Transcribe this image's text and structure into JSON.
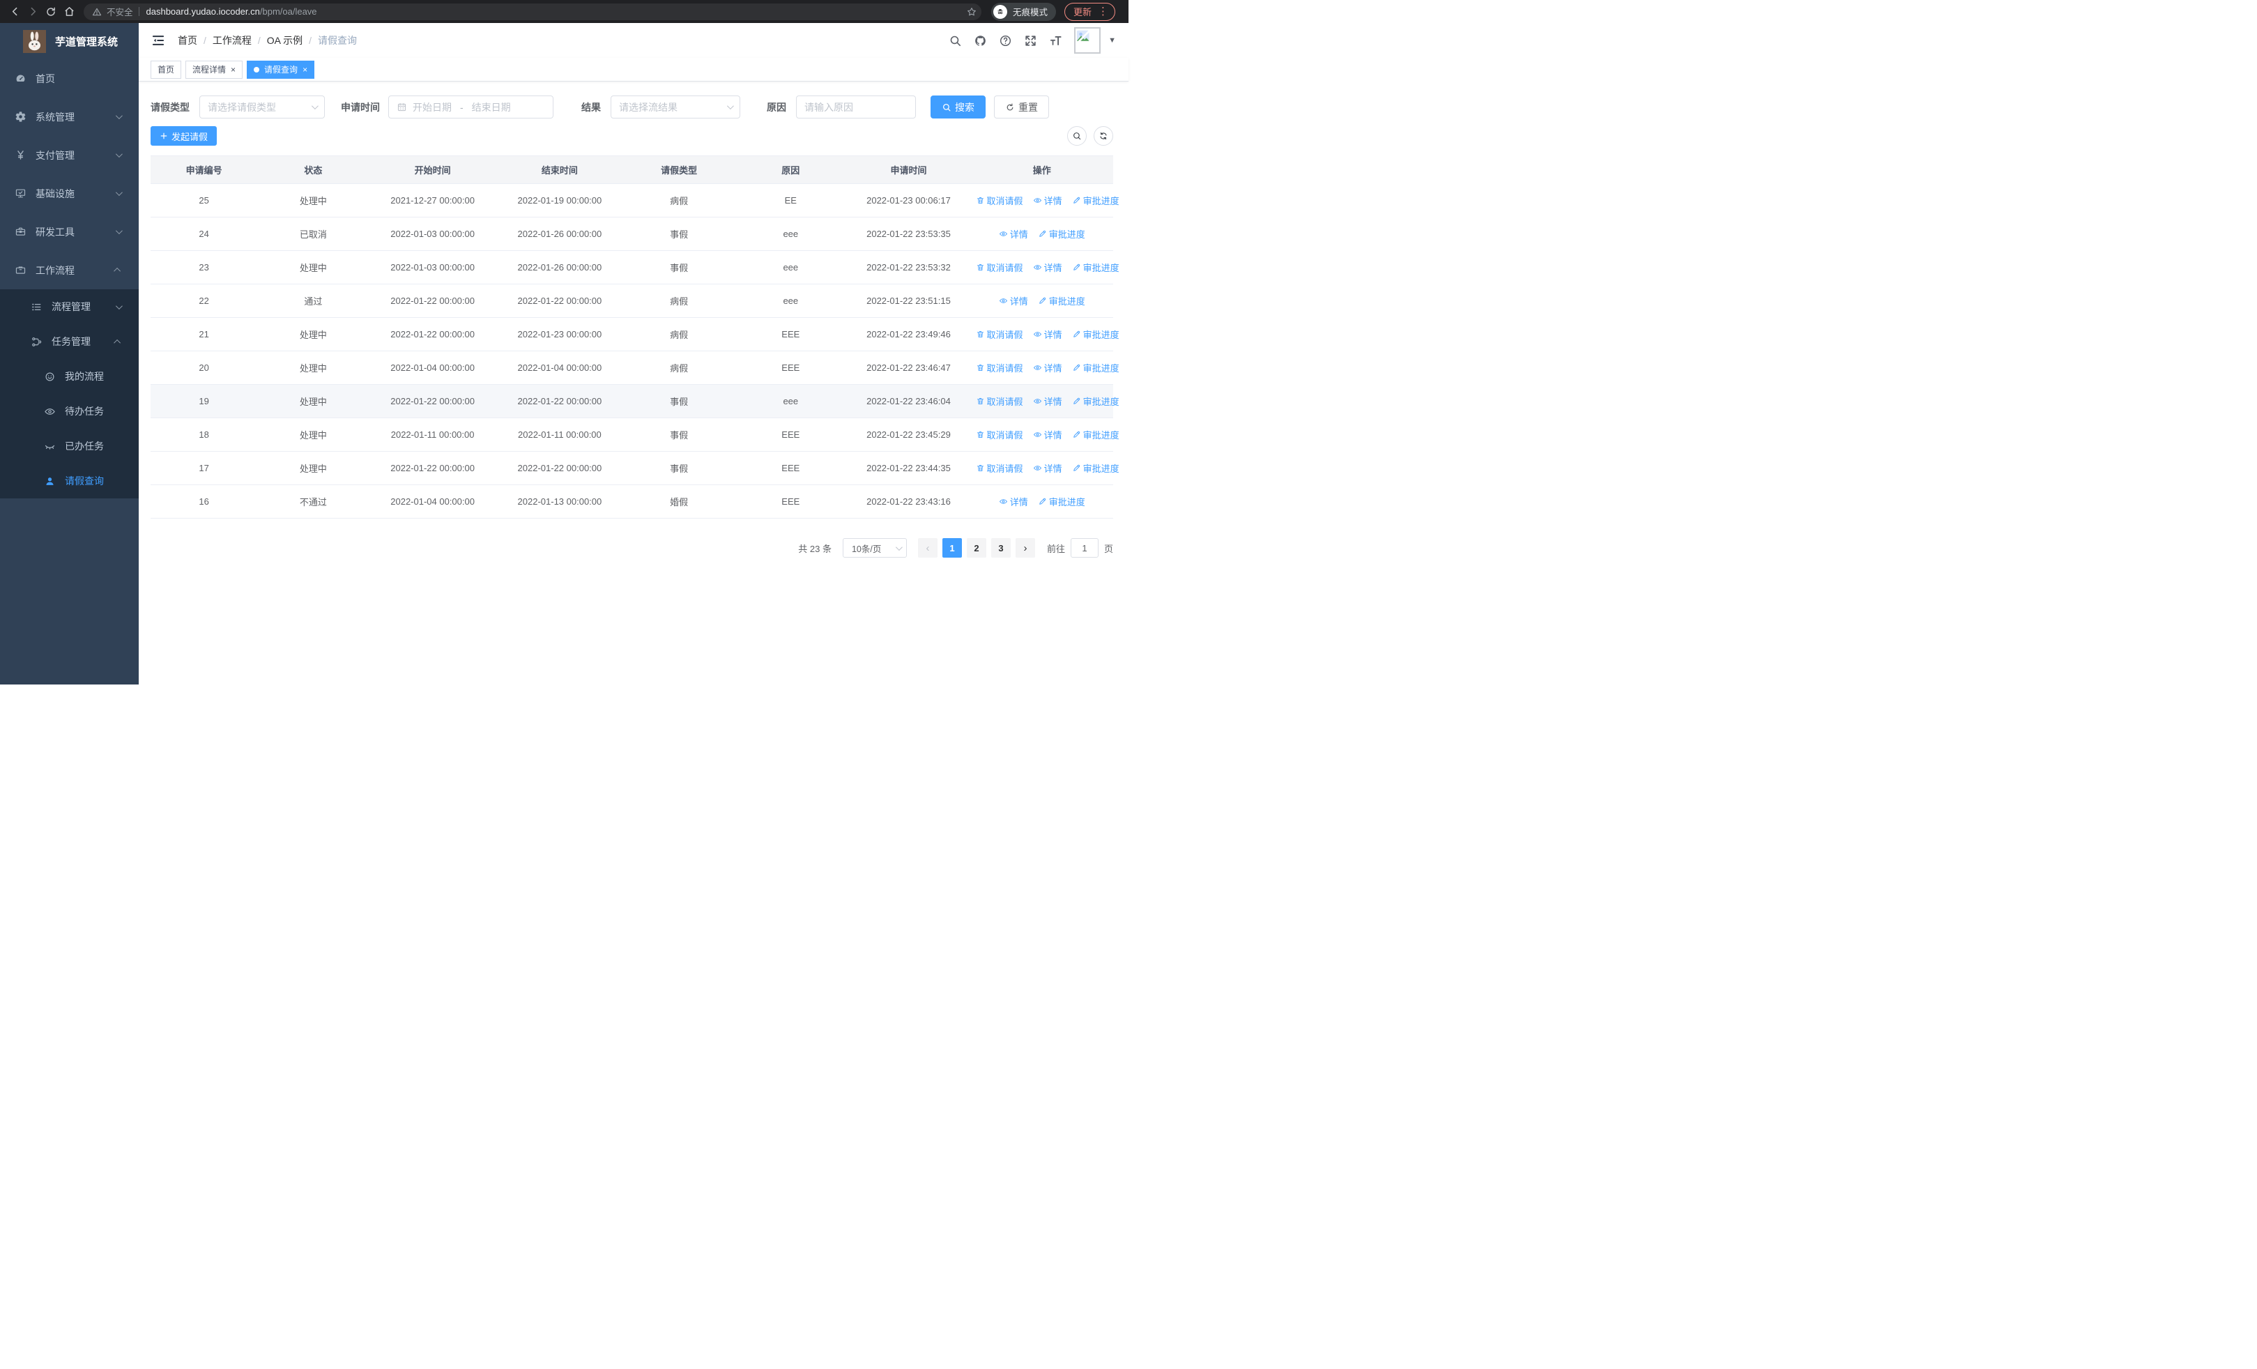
{
  "browser": {
    "security_label": "不安全",
    "url_host": "dashboard.yudao.iocoder.cn",
    "url_path": "/bpm/oa/leave",
    "incognito_label": "无痕模式",
    "update_label": "更新"
  },
  "sidebar": {
    "title": "芋道管理系统",
    "menu": [
      {
        "key": "home",
        "label": "首页",
        "icon": "dashboard",
        "level": 1,
        "chevron": "",
        "active": false
      },
      {
        "key": "system",
        "label": "系统管理",
        "icon": "gear",
        "level": 1,
        "chevron": "down",
        "active": false
      },
      {
        "key": "payment",
        "label": "支付管理",
        "icon": "yen",
        "level": 1,
        "chevron": "down",
        "active": false
      },
      {
        "key": "infrastructure",
        "label": "基础设施",
        "icon": "monitor",
        "level": 1,
        "chevron": "down",
        "active": false
      },
      {
        "key": "dev-tools",
        "label": "研发工具",
        "icon": "toolbox",
        "level": 1,
        "chevron": "down",
        "active": false
      },
      {
        "key": "workflow",
        "label": "工作流程",
        "icon": "briefcase",
        "level": 1,
        "chevron": "up",
        "active": false
      },
      {
        "key": "process-mgmt",
        "label": "流程管理",
        "icon": "list",
        "level": 2,
        "chevron": "down",
        "active": false
      },
      {
        "key": "task-mgmt",
        "label": "任务管理",
        "icon": "flow",
        "level": 2,
        "chevron": "up",
        "active": false
      },
      {
        "key": "my-process",
        "label": "我的流程",
        "icon": "face",
        "level": 3,
        "chevron": "",
        "active": false
      },
      {
        "key": "todo-tasks",
        "label": "待办任务",
        "icon": "eye",
        "level": 3,
        "chevron": "",
        "active": false
      },
      {
        "key": "done-tasks",
        "label": "已办任务",
        "icon": "eye-closed",
        "level": 3,
        "chevron": "",
        "active": false
      },
      {
        "key": "leave-query",
        "label": "请假查询",
        "icon": "user",
        "level": 3,
        "chevron": "",
        "active": true
      }
    ]
  },
  "header": {
    "breadcrumbs": [
      "首页",
      "工作流程",
      "OA 示例",
      "请假查询"
    ]
  },
  "tabs": [
    {
      "key": "home",
      "label": "首页",
      "closable": false,
      "active": false
    },
    {
      "key": "process-detail",
      "label": "流程详情",
      "closable": true,
      "active": false
    },
    {
      "key": "leave-query",
      "label": "请假查询",
      "closable": true,
      "active": true
    }
  ],
  "filters": {
    "leave_type_label": "请假类型",
    "leave_type_placeholder": "请选择请假类型",
    "apply_time_label": "申请时间",
    "date_start_placeholder": "开始日期",
    "date_separator": "-",
    "date_end_placeholder": "结束日期",
    "result_label": "结果",
    "result_placeholder": "请选择流结果",
    "reason_label": "原因",
    "reason_placeholder": "请输入原因",
    "search_label": "搜索",
    "reset_label": "重置"
  },
  "toolbar": {
    "create_label": "发起请假"
  },
  "table": {
    "columns": [
      "申请编号",
      "状态",
      "开始时间",
      "结束时间",
      "请假类型",
      "原因",
      "申请时间",
      "操作"
    ],
    "action_labels": {
      "cancel": "取消请假",
      "detail": "详情",
      "progress": "审批进度"
    },
    "rows": [
      {
        "id": "25",
        "status": "处理中",
        "start": "2021-12-27 00:00:00",
        "end": "2022-01-19 00:00:00",
        "type": "病假",
        "reason": "EE",
        "applied": "2022-01-23 00:06:17",
        "cancellable": true,
        "highlight": false
      },
      {
        "id": "24",
        "status": "已取消",
        "start": "2022-01-03 00:00:00",
        "end": "2022-01-26 00:00:00",
        "type": "事假",
        "reason": "eee",
        "applied": "2022-01-22 23:53:35",
        "cancellable": false,
        "highlight": false
      },
      {
        "id": "23",
        "status": "处理中",
        "start": "2022-01-03 00:00:00",
        "end": "2022-01-26 00:00:00",
        "type": "事假",
        "reason": "eee",
        "applied": "2022-01-22 23:53:32",
        "cancellable": true,
        "highlight": false
      },
      {
        "id": "22",
        "status": "通过",
        "start": "2022-01-22 00:00:00",
        "end": "2022-01-22 00:00:00",
        "type": "病假",
        "reason": "eee",
        "applied": "2022-01-22 23:51:15",
        "cancellable": false,
        "highlight": false
      },
      {
        "id": "21",
        "status": "处理中",
        "start": "2022-01-22 00:00:00",
        "end": "2022-01-23 00:00:00",
        "type": "病假",
        "reason": "EEE",
        "applied": "2022-01-22 23:49:46",
        "cancellable": true,
        "highlight": false
      },
      {
        "id": "20",
        "status": "处理中",
        "start": "2022-01-04 00:00:00",
        "end": "2022-01-04 00:00:00",
        "type": "病假",
        "reason": "EEE",
        "applied": "2022-01-22 23:46:47",
        "cancellable": true,
        "highlight": false
      },
      {
        "id": "19",
        "status": "处理中",
        "start": "2022-01-22 00:00:00",
        "end": "2022-01-22 00:00:00",
        "type": "事假",
        "reason": "eee",
        "applied": "2022-01-22 23:46:04",
        "cancellable": true,
        "highlight": true
      },
      {
        "id": "18",
        "status": "处理中",
        "start": "2022-01-11 00:00:00",
        "end": "2022-01-11 00:00:00",
        "type": "事假",
        "reason": "EEE",
        "applied": "2022-01-22 23:45:29",
        "cancellable": true,
        "highlight": false
      },
      {
        "id": "17",
        "status": "处理中",
        "start": "2022-01-22 00:00:00",
        "end": "2022-01-22 00:00:00",
        "type": "事假",
        "reason": "EEE",
        "applied": "2022-01-22 23:44:35",
        "cancellable": true,
        "highlight": false
      },
      {
        "id": "16",
        "status": "不通过",
        "start": "2022-01-04 00:00:00",
        "end": "2022-01-13 00:00:00",
        "type": "婚假",
        "reason": "EEE",
        "applied": "2022-01-22 23:43:16",
        "cancellable": false,
        "highlight": false
      }
    ]
  },
  "pagination": {
    "total_label": "共 23 条",
    "page_size": "10条/页",
    "pages": [
      "1",
      "2",
      "3"
    ],
    "active_page": "1",
    "prev_symbol": "‹",
    "next_symbol": "›",
    "goto_label": "前往",
    "goto_value": "1",
    "page_unit": "页"
  },
  "colors": {
    "accent": "#409eff",
    "sidebar_bg": "#304156",
    "submenu_bg": "#1f2d3d",
    "browser_bg": "#202124",
    "update_accent": "#f28b82",
    "table_header_bg": "#f4f5f7"
  }
}
